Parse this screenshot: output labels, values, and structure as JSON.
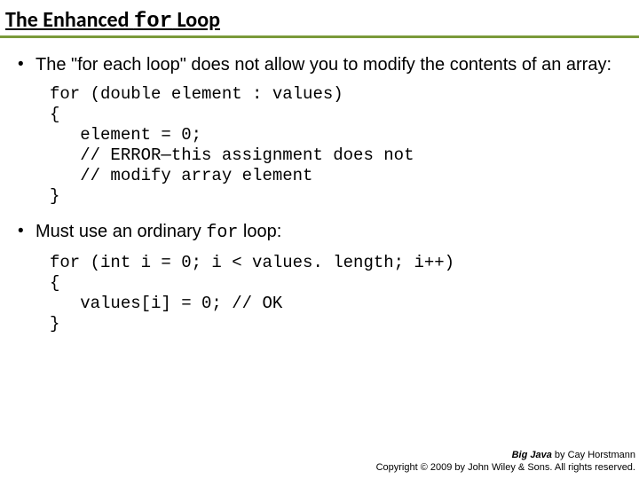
{
  "title": {
    "pre": "The Enhanced ",
    "code": "for",
    "post": " Loop"
  },
  "bullets": {
    "b1": "The \"for each loop\" does not allow you to modify the contents of an array:",
    "b2_pre": "Must use an ordinary ",
    "b2_code": "for",
    "b2_post": " loop:"
  },
  "code1": "for (double element : values)\n{\n   element = 0;\n   // ERROR—this assignment does not\n   // modify array element\n}",
  "code2": "for (int i = 0; i < values. length; i++)\n{\n   values[i] = 0; // OK\n}",
  "footer": {
    "book": "Big Java",
    "author": " by Cay Horstmann",
    "copyright": "Copyright © 2009 by John Wiley & Sons.  All rights reserved."
  }
}
